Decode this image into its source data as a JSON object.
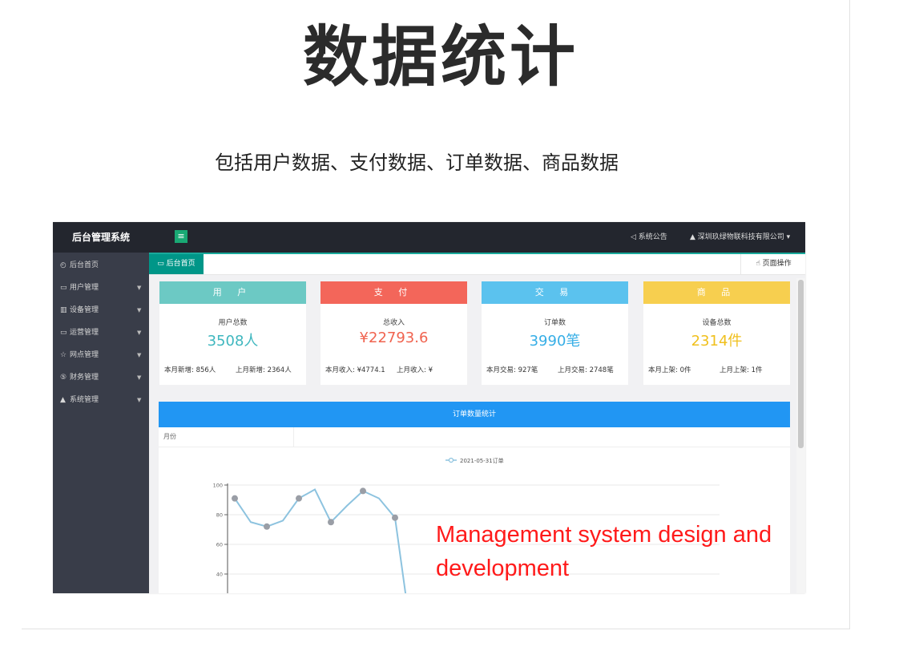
{
  "hero": {
    "title": "数据统计",
    "subtitle": "包括用户数据、支付数据、订单数据、商品数据"
  },
  "app": {
    "brand": "后台管理系统",
    "menu_icon": "hamburger-icon",
    "announce": "◁ 系统公告",
    "company": "▲ 深圳玖绿物联科技有限公司 ▾"
  },
  "sidebar": {
    "items": [
      {
        "icon": "◴",
        "label": "后台首页",
        "has_arrow": false
      },
      {
        "icon": "▭",
        "label": "用户管理",
        "has_arrow": true
      },
      {
        "icon": "▥",
        "label": "设备管理",
        "has_arrow": true
      },
      {
        "icon": "▭",
        "label": "运营管理",
        "has_arrow": true
      },
      {
        "icon": "☆",
        "label": "网点管理",
        "has_arrow": true
      },
      {
        "icon": "⑤",
        "label": "财务管理",
        "has_arrow": true
      },
      {
        "icon": "▲",
        "label": "系统管理",
        "has_arrow": true
      }
    ]
  },
  "tabs": {
    "home": "后台首页",
    "page_ops": "页面操作"
  },
  "cards": [
    {
      "head": "用 户",
      "head_color": "#6cc9c4",
      "value_color": "#3fb7bf",
      "label": "用户总数",
      "value": "3508人",
      "foot_left": "本月新增: 856人",
      "foot_right": "上月新增: 2364人"
    },
    {
      "head": "支 付",
      "head_color": "#f3665a",
      "value_color": "#f0634f",
      "label": "总收入",
      "value": "¥22793.6",
      "foot_left": "本月收入: ¥4774.1",
      "foot_right": "上月收入: ¥"
    },
    {
      "head": "交 易",
      "head_color": "#5bc2ee",
      "value_color": "#36aee6",
      "label": "订单数",
      "value": "3990笔",
      "foot_left": "本月交易: 927笔",
      "foot_right": "上月交易: 2748笔"
    },
    {
      "head": "商 品",
      "head_color": "#f7cf4f",
      "value_color": "#f0c01d",
      "label": "设备总数",
      "value": "2314件",
      "foot_left": "本月上架: 0件",
      "foot_right": "上月上架: 1件"
    }
  ],
  "chart_panel": {
    "title": "订单数量统计",
    "month_label": "月份"
  },
  "chart_data": {
    "type": "line",
    "series": [
      {
        "name": "2021-05-31订单",
        "color": "#8dc3df",
        "values": [
          91,
          75,
          72,
          76,
          91,
          97,
          75,
          86,
          96,
          91,
          78,
          0
        ]
      }
    ],
    "yticks": [
      "100",
      "80",
      "60",
      "40"
    ],
    "ylim": [
      0,
      100
    ],
    "grid": true,
    "legend_position": "top-center"
  },
  "overlay": {
    "line1": "Management system design and",
    "line2": "development"
  }
}
